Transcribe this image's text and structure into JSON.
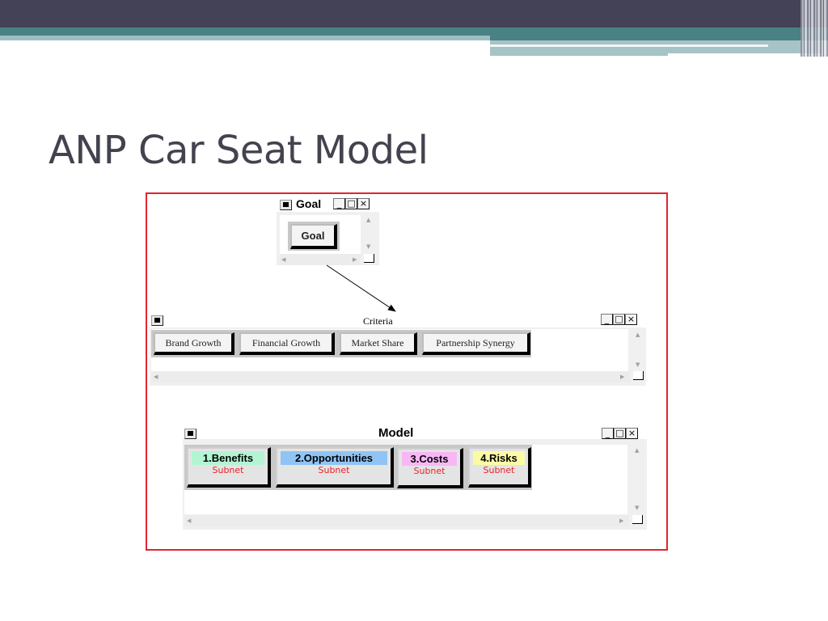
{
  "slide": {
    "title": "ANP Car Seat Model"
  },
  "goal_window": {
    "title": "Goal",
    "controls": [
      "_",
      "□",
      "×"
    ],
    "nodes": [
      {
        "label": "Goal"
      }
    ]
  },
  "criteria_window": {
    "title": "Criteria",
    "controls": [
      "_",
      "□",
      "×"
    ],
    "nodes": [
      {
        "label": "Brand Growth"
      },
      {
        "label": "Financial Growth"
      },
      {
        "label": "Market Share"
      },
      {
        "label": "Partnership Synergy"
      }
    ]
  },
  "model_window": {
    "title": "Model",
    "controls": [
      "_",
      "□",
      "×"
    ],
    "nodes": [
      {
        "label": "1.Benefits",
        "sub": "Subnet",
        "color": "#b3f5d3"
      },
      {
        "label": "2.Opportunities",
        "sub": "Subnet",
        "color": "#8fc4f5"
      },
      {
        "label": "3.Costs",
        "sub": "Subnet",
        "color": "#f7b7f5"
      },
      {
        "label": "4.Risks",
        "sub": "Subnet",
        "color": "#fbfba6"
      }
    ]
  },
  "icons": {
    "system_menu": "system-menu-icon",
    "minimize": "minimize-icon",
    "maximize": "maximize-icon",
    "close": "close-icon",
    "scroll_up": "▲",
    "scroll_down": "▼",
    "scroll_left": "◀",
    "scroll_right": "▶"
  },
  "colors": {
    "header_dark": "#434256",
    "header_teal": "#4a8184",
    "frame_border": "#e0252d",
    "subnet_text": "#e8222a"
  }
}
